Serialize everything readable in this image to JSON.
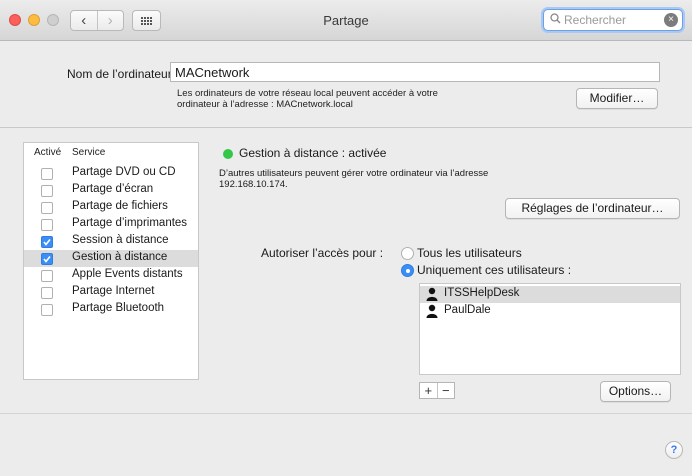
{
  "window": {
    "title": "Partage"
  },
  "toolbar": {
    "back_glyph": "‹",
    "forward_glyph": "›",
    "search_placeholder": "Rechercher",
    "search_clear_glyph": "×"
  },
  "computer": {
    "name_label": "Nom de l’ordinateur :",
    "name_value": "MACnetwork",
    "description_line1": "Les ordinateurs de votre réseau local peuvent accéder à votre",
    "description_line2": "ordinateur à l’adresse : MACnetwork.local",
    "modify_button": "Modifier…"
  },
  "services": {
    "header_active": "Activé",
    "header_service": "Service",
    "items": [
      {
        "label": "Partage DVD ou CD",
        "checked": false,
        "selected": false
      },
      {
        "label": "Partage d’écran",
        "checked": false,
        "selected": false
      },
      {
        "label": "Partage de fichiers",
        "checked": false,
        "selected": false
      },
      {
        "label": "Partage d’imprimantes",
        "checked": false,
        "selected": false
      },
      {
        "label": "Session à distance",
        "checked": true,
        "selected": false
      },
      {
        "label": "Gestion à distance",
        "checked": true,
        "selected": true
      },
      {
        "label": "Apple Events distants",
        "checked": false,
        "selected": false
      },
      {
        "label": "Partage Internet",
        "checked": false,
        "selected": false
      },
      {
        "label": "Partage Bluetooth",
        "checked": false,
        "selected": false
      }
    ]
  },
  "detail": {
    "status_color": "#33c748",
    "status_text": "Gestion à distance : activée",
    "description_line1": "D’autres utilisateurs peuvent gérer votre ordinateur via l’adresse",
    "description_line2": "192.168.10.174.",
    "settings_button": "Réglages de l’ordinateur…",
    "access_label": "Autoriser l’accès pour :",
    "option_all": "Tous les utilisateurs",
    "option_only": "Uniquement ces utilisateurs :",
    "selected_option": "only",
    "users": [
      {
        "name": "ITSSHelpDesk",
        "selected": true
      },
      {
        "name": "PaulDale",
        "selected": false
      }
    ],
    "add_glyph": "+",
    "remove_glyph": "−",
    "options_button": "Options…"
  },
  "help": {
    "glyph": "?"
  },
  "colors": {
    "accent": "#3b8ef6",
    "selection": "#dcdcdc",
    "close": "#fc605b",
    "minimize": "#fdbc40"
  }
}
